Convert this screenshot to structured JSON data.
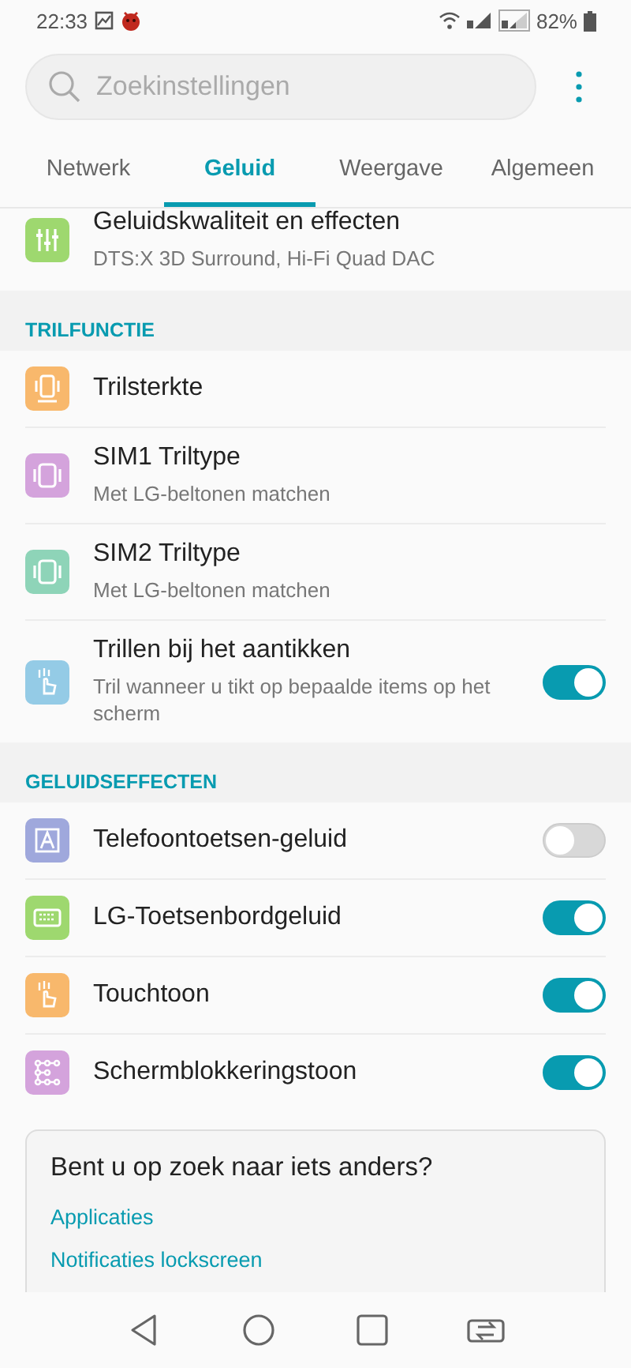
{
  "status_bar": {
    "time": "22:33",
    "battery": "82%"
  },
  "search": {
    "placeholder": "Zoekinstellingen"
  },
  "tabs": [
    {
      "label": "Netwerk",
      "selected": false
    },
    {
      "label": "Geluid",
      "selected": true
    },
    {
      "label": "Weergave",
      "selected": false
    },
    {
      "label": "Algemeen",
      "selected": false
    }
  ],
  "sections": [
    {
      "items": [
        {
          "kind": "plain",
          "title": "Geluidskwaliteit en effecten",
          "subtitle": "DTS:X 3D Surround, Hi-Fi Quad DAC",
          "color": "#9ed86f"
        }
      ]
    },
    {
      "header": "TRILFUNCTIE",
      "items": [
        {
          "kind": "plain",
          "title": "Trilsterkte",
          "color": "#f8b86c"
        },
        {
          "kind": "plain",
          "title": "SIM1 Triltype",
          "subtitle": "Met LG-beltonen matchen",
          "color": "#d4a3dc"
        },
        {
          "kind": "plain",
          "title": "SIM2 Triltype",
          "subtitle": "Met LG-beltonen matchen",
          "color": "#8ed4b8"
        },
        {
          "kind": "toggle",
          "title": "Trillen bij het aantikken",
          "subtitle": "Tril wanneer u tikt op bepaalde items op het scherm",
          "color": "#94cbe6",
          "on": true
        }
      ]
    },
    {
      "header": "GELUIDSEFFECTEN",
      "items": [
        {
          "kind": "toggle",
          "title": "Telefoontoetsen-geluid",
          "color": "#9fa8dc",
          "on": false
        },
        {
          "kind": "toggle",
          "title": "LG-Toetsenbordgeluid",
          "color": "#9ed86f",
          "on": true
        },
        {
          "kind": "toggle",
          "title": "Touchtoon",
          "color": "#f8b86c",
          "on": true
        },
        {
          "kind": "toggle",
          "title": "Schermblokkeringstoon",
          "color": "#d4a3dc",
          "on": true
        }
      ]
    }
  ],
  "suggestions": {
    "title": "Bent u op zoek naar iets anders?",
    "links": [
      "Applicaties",
      "Notificaties lockscreen"
    ]
  }
}
